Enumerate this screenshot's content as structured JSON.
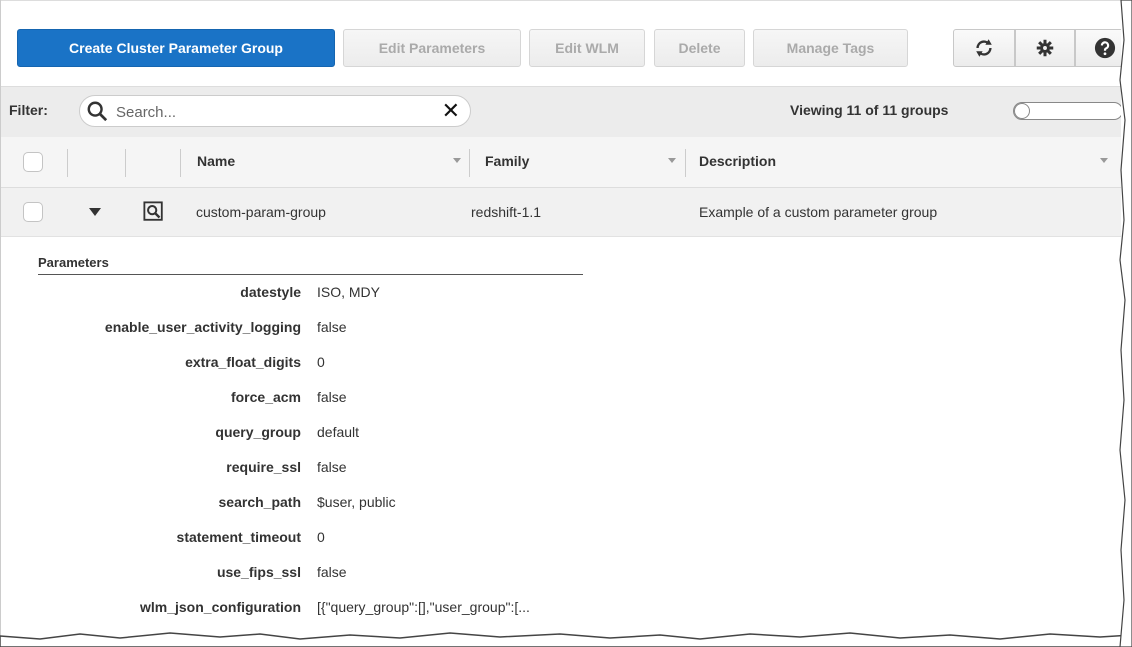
{
  "toolbar": {
    "create_label": "Create Cluster Parameter Group",
    "edit_params_label": "Edit Parameters",
    "edit_wlm_label": "Edit WLM",
    "delete_label": "Delete",
    "manage_tags_label": "Manage Tags",
    "refresh_icon": "refresh-icon",
    "settings_icon": "gear-icon",
    "help_icon": "help-icon"
  },
  "filter": {
    "label": "Filter:",
    "placeholder": "Search...",
    "clear_glyph": "✕",
    "viewing": "Viewing 11 of 11 groups"
  },
  "table": {
    "columns": [
      "Name",
      "Family",
      "Description"
    ],
    "row": {
      "name": "custom-param-group",
      "family": "redshift-1.1",
      "description": "Example of a custom parameter group"
    }
  },
  "details": {
    "heading": "Parameters",
    "params": [
      {
        "key": "datestyle",
        "value": "ISO, MDY"
      },
      {
        "key": "enable_user_activity_logging",
        "value": "false"
      },
      {
        "key": "extra_float_digits",
        "value": "0"
      },
      {
        "key": "force_acm",
        "value": "false"
      },
      {
        "key": "query_group",
        "value": "default"
      },
      {
        "key": "require_ssl",
        "value": "false"
      },
      {
        "key": "search_path",
        "value": "$user, public"
      },
      {
        "key": "statement_timeout",
        "value": "0"
      },
      {
        "key": "use_fips_ssl",
        "value": "false"
      },
      {
        "key": "wlm_json_configuration",
        "value": "[{\"query_group\":[],\"user_group\":[..."
      }
    ]
  },
  "colors": {
    "primary": "#1a73c6",
    "filter_bg": "#ececec",
    "row_bg": "#f1f1f1"
  }
}
